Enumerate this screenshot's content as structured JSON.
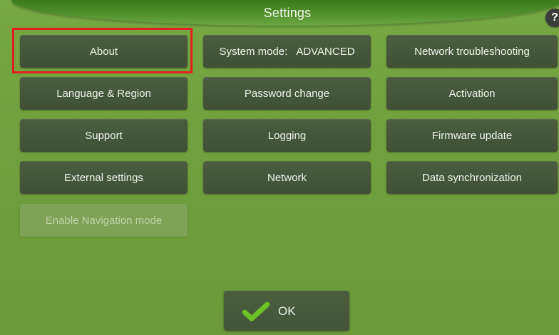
{
  "header": {
    "title": "Settings",
    "help_label": "?"
  },
  "buttons": {
    "about": "About",
    "language_region": "Language & Region",
    "support": "Support",
    "external_settings": "External settings",
    "enable_navigation_mode": "Enable Navigation mode",
    "system_mode_label": "System mode:",
    "system_mode_value": "ADVANCED",
    "password_change": "Password change",
    "logging": "Logging",
    "network": "Network",
    "network_troubleshooting": "Network troubleshooting",
    "activation": "Activation",
    "firmware_update": "Firmware update",
    "data_synchronization": "Data synchronization"
  },
  "footer": {
    "ok_label": "OK"
  },
  "colors": {
    "background": "#6e9f3e",
    "button": "#45573b",
    "disabled_button": "#7ea357",
    "highlight": "#e11f1f",
    "check": "#6fc225"
  },
  "icons": {
    "ok_check": "check-icon",
    "help": "question-mark-icon"
  }
}
